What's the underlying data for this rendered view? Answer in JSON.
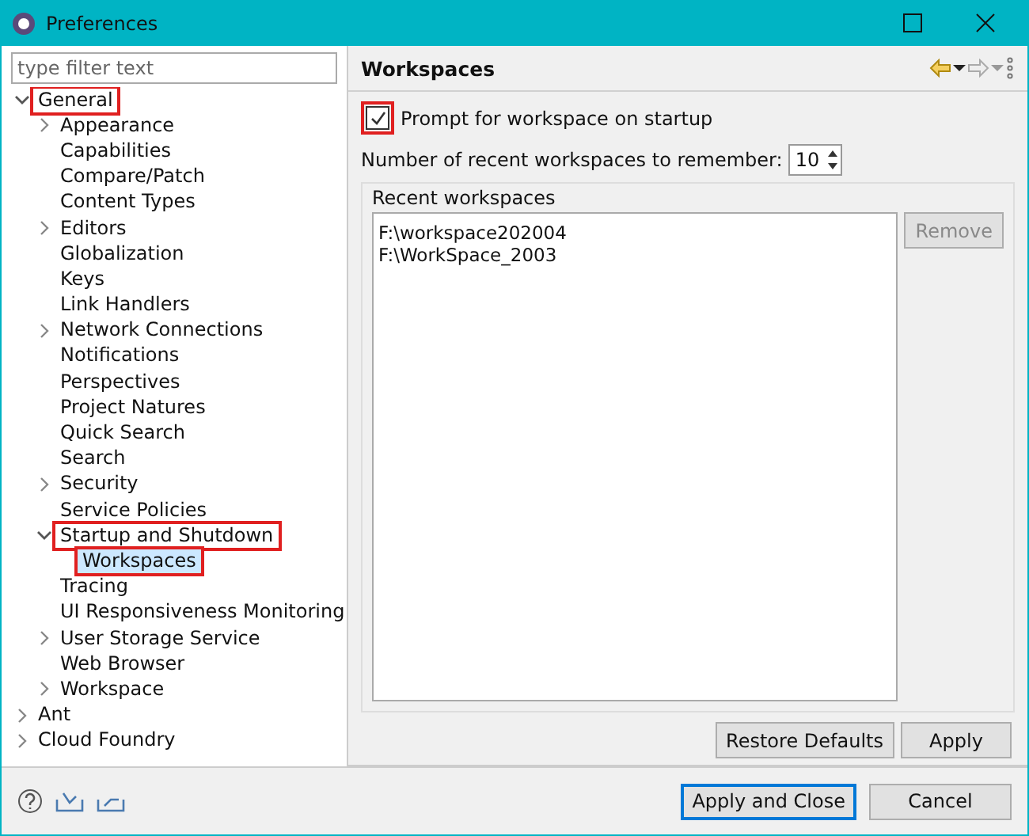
{
  "window": {
    "title": "Preferences"
  },
  "filter": {
    "placeholder": "type filter text"
  },
  "tree": [
    {
      "label": "General",
      "expanded": true,
      "highlighted": true,
      "selected": false,
      "children": [
        {
          "label": "Appearance",
          "expandable": true,
          "selected": false
        },
        {
          "label": "Capabilities",
          "expandable": false,
          "selected": false
        },
        {
          "label": "Compare/Patch",
          "expandable": false,
          "selected": false
        },
        {
          "label": "Content Types",
          "expandable": false,
          "selected": false
        },
        {
          "label": "Editors",
          "expandable": true,
          "selected": false
        },
        {
          "label": "Globalization",
          "expandable": false,
          "selected": false
        },
        {
          "label": "Keys",
          "expandable": false,
          "selected": false
        },
        {
          "label": "Link Handlers",
          "expandable": false,
          "selected": false
        },
        {
          "label": "Network Connections",
          "expandable": true,
          "selected": false
        },
        {
          "label": "Notifications",
          "expandable": false,
          "selected": false
        },
        {
          "label": "Perspectives",
          "expandable": false,
          "selected": false
        },
        {
          "label": "Project Natures",
          "expandable": false,
          "selected": false
        },
        {
          "label": "Quick Search",
          "expandable": false,
          "selected": false
        },
        {
          "label": "Search",
          "expandable": false,
          "selected": false
        },
        {
          "label": "Security",
          "expandable": true,
          "selected": false
        },
        {
          "label": "Service Policies",
          "expandable": false,
          "selected": false
        },
        {
          "label": "Startup and Shutdown",
          "expanded": true,
          "highlighted": true,
          "selected": false,
          "children": [
            {
              "label": "Workspaces",
              "expandable": false,
              "selected": true,
              "highlighted": true
            }
          ]
        },
        {
          "label": "Tracing",
          "expandable": false,
          "selected": false
        },
        {
          "label": "UI Responsiveness Monitoring",
          "expandable": false,
          "selected": false
        },
        {
          "label": "User Storage Service",
          "expandable": true,
          "selected": false
        },
        {
          "label": "Web Browser",
          "expandable": false,
          "selected": false
        },
        {
          "label": "Workspace",
          "expandable": true,
          "selected": false
        }
      ]
    },
    {
      "label": "Ant",
      "expandable": true,
      "selected": false
    },
    {
      "label": "Cloud Foundry",
      "expandable": true,
      "selected": false
    }
  ],
  "page": {
    "title": "Workspaces",
    "prompt": {
      "label": "Prompt for workspace on startup",
      "checked": true,
      "highlighted": true
    },
    "count": {
      "label": "Number of recent workspaces to remember:",
      "value": "10"
    },
    "recent": {
      "title": "Recent workspaces",
      "items": [
        "F:\\workspace202004",
        "F:\\WorkSpace_2003"
      ],
      "remove": {
        "label": "Remove",
        "disabled": true
      }
    },
    "buttons": [
      "Restore Defaults",
      "Apply"
    ]
  },
  "footer": {
    "buttons": [
      {
        "label": "Apply and Close",
        "default": true
      },
      {
        "label": "Cancel",
        "default": false
      }
    ]
  }
}
